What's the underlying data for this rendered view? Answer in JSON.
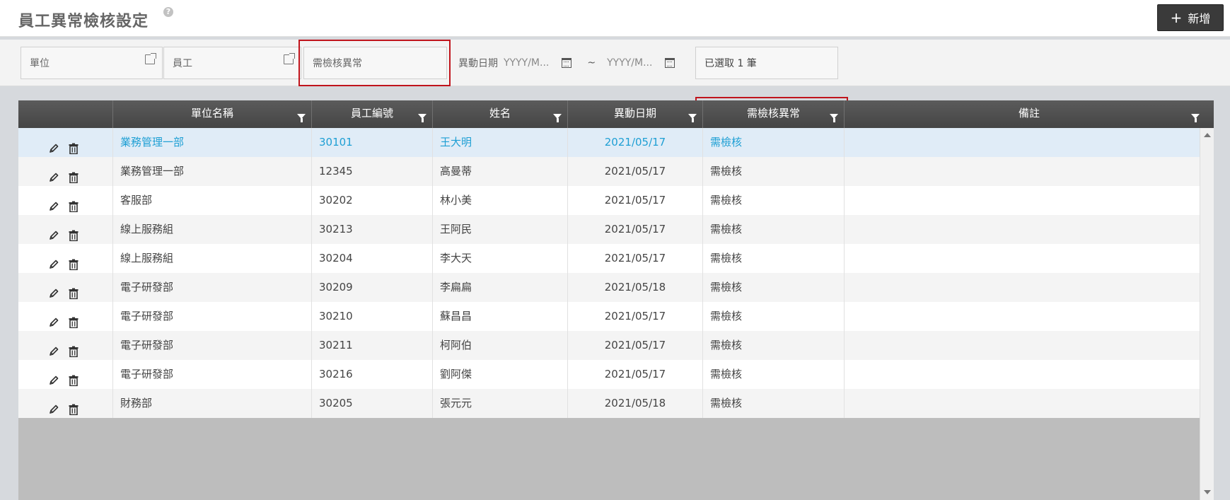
{
  "header": {
    "title": "員工異常檢核設定",
    "help_glyph": "?",
    "add_label": "新增",
    "add_glyph": "+"
  },
  "filters": {
    "unit_placeholder": "單位",
    "employee_placeholder": "員工",
    "abnormal_placeholder": "需檢核異常",
    "date_label": "異動日期",
    "date_from_placeholder": "YYYY/M...",
    "date_separator": "~",
    "date_to_placeholder": "YYYY/M...",
    "selected_text": "已選取 1 筆"
  },
  "grid": {
    "columns": [
      "",
      "單位名稱",
      "員工編號",
      "姓名",
      "異動日期",
      "需檢核異常",
      "備註"
    ],
    "rows": [
      {
        "unit": "業務管理一部",
        "id": "30101",
        "name": "王大明",
        "date": "2021/05/17",
        "check": "需檢核",
        "note": ""
      },
      {
        "unit": "業務管理一部",
        "id": "12345",
        "name": "高曼蒂",
        "date": "2021/05/17",
        "check": "需檢核",
        "note": ""
      },
      {
        "unit": "客服部",
        "id": "30202",
        "name": "林小美",
        "date": "2021/05/17",
        "check": "需檢核",
        "note": ""
      },
      {
        "unit": "線上服務組",
        "id": "30213",
        "name": "王阿民",
        "date": "2021/05/17",
        "check": "需檢核",
        "note": ""
      },
      {
        "unit": "線上服務組",
        "id": "30204",
        "name": "李大天",
        "date": "2021/05/17",
        "check": "需檢核",
        "note": ""
      },
      {
        "unit": "電子研發部",
        "id": "30209",
        "name": "李扁扁",
        "date": "2021/05/18",
        "check": "需檢核",
        "note": ""
      },
      {
        "unit": "電子研發部",
        "id": "30210",
        "name": "蘇昌昌",
        "date": "2021/05/17",
        "check": "需檢核",
        "note": ""
      },
      {
        "unit": "電子研發部",
        "id": "30211",
        "name": "柯阿伯",
        "date": "2021/05/17",
        "check": "需檢核",
        "note": ""
      },
      {
        "unit": "電子研發部",
        "id": "30216",
        "name": "劉阿傑",
        "date": "2021/05/17",
        "check": "需檢核",
        "note": ""
      },
      {
        "unit": "財務部",
        "id": "30205",
        "name": "張元元",
        "date": "2021/05/18",
        "check": "需檢核",
        "note": ""
      }
    ],
    "selected_row": 0
  },
  "colors": {
    "highlight_red": "#c0141c",
    "selected_text": "#1e9fd4",
    "header_dark": "#454545"
  }
}
